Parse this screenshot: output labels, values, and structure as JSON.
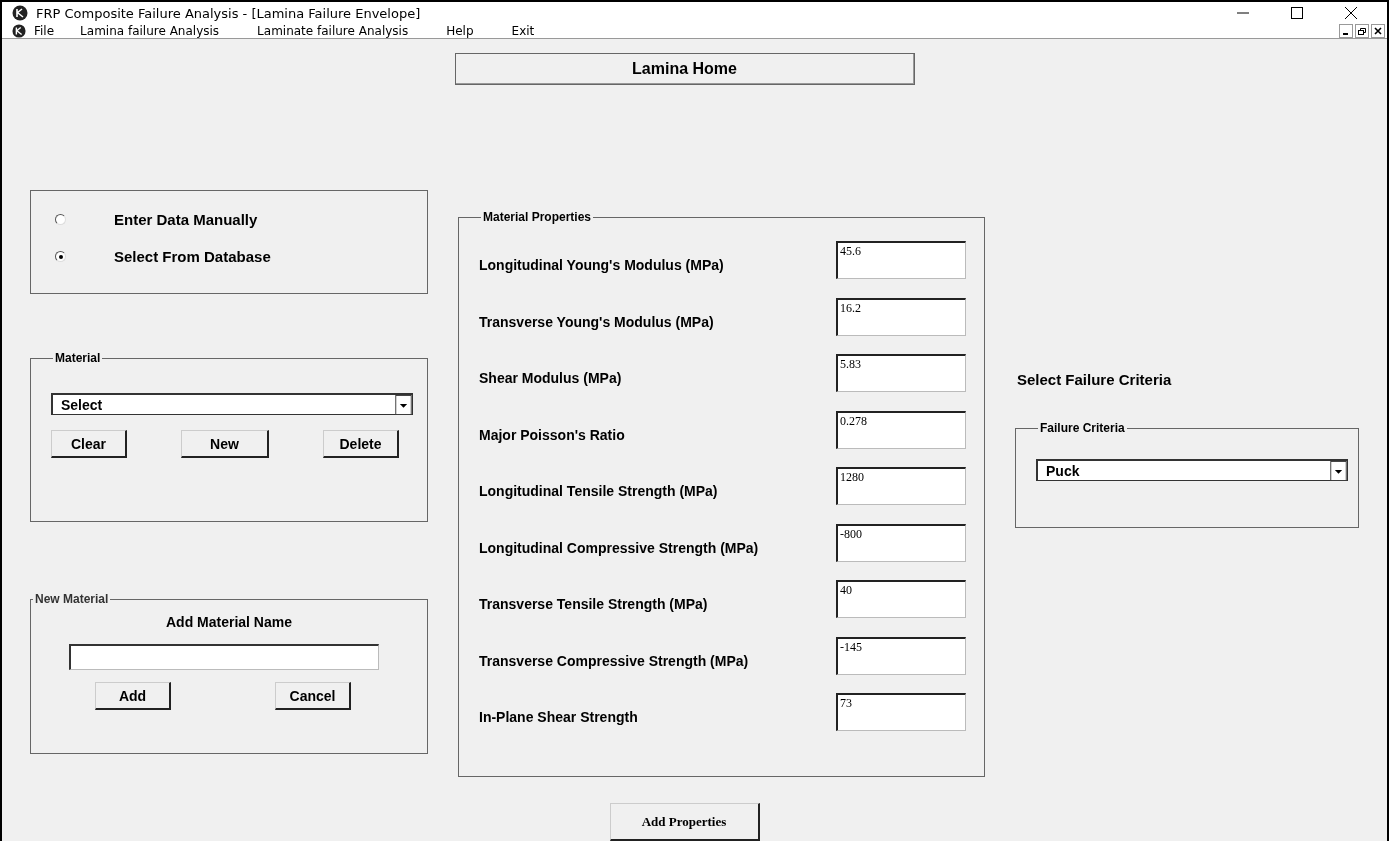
{
  "window": {
    "title": "FRP Composite Failure Analysis - [Lamina Failure Envelope]"
  },
  "menu": [
    "File",
    "Lamina failure Analysis",
    "Laminate failure Analysis",
    "Help",
    "Exit"
  ],
  "heading": "Lamina Home",
  "data_source": [
    {
      "label": "Enter Data Manually",
      "selected": false
    },
    {
      "label": "Select From Database",
      "selected": true
    }
  ],
  "material": {
    "legend": "Material",
    "combo": "Select",
    "buttons": [
      "Clear",
      "New",
      "Delete"
    ]
  },
  "new_material": {
    "legend": "New Material",
    "label": "Add Material  Name",
    "buttons": [
      "Add",
      "Cancel"
    ]
  },
  "material_properties": {
    "legend": "Material Properties",
    "rows": [
      {
        "label": "Longitudinal Young's Modulus (MPa)",
        "value": "45.6"
      },
      {
        "label": "Transverse Young's Modulus (MPa)",
        "value": "16.2"
      },
      {
        "label": "Shear Modulus (MPa)",
        "value": "5.83"
      },
      {
        "label": "Major Poisson's Ratio",
        "value": "0.278"
      },
      {
        "label": "Longitudinal Tensile Strength (MPa)",
        "value": "1280"
      },
      {
        "label": "Longitudinal Compressive Strength (MPa)",
        "value": "-800"
      },
      {
        "label": "Transverse Tensile Strength (MPa)",
        "value": "40"
      },
      {
        "label": "Transverse Compressive Strength (MPa)",
        "value": "-145"
      },
      {
        "label": "In-Plane Shear Strength",
        "value": "73"
      }
    ]
  },
  "failure": {
    "heading": "Select Failure Criteria",
    "legend": "Failure Criteria",
    "combo": "Puck"
  },
  "add_properties_button": "Add Properties"
}
